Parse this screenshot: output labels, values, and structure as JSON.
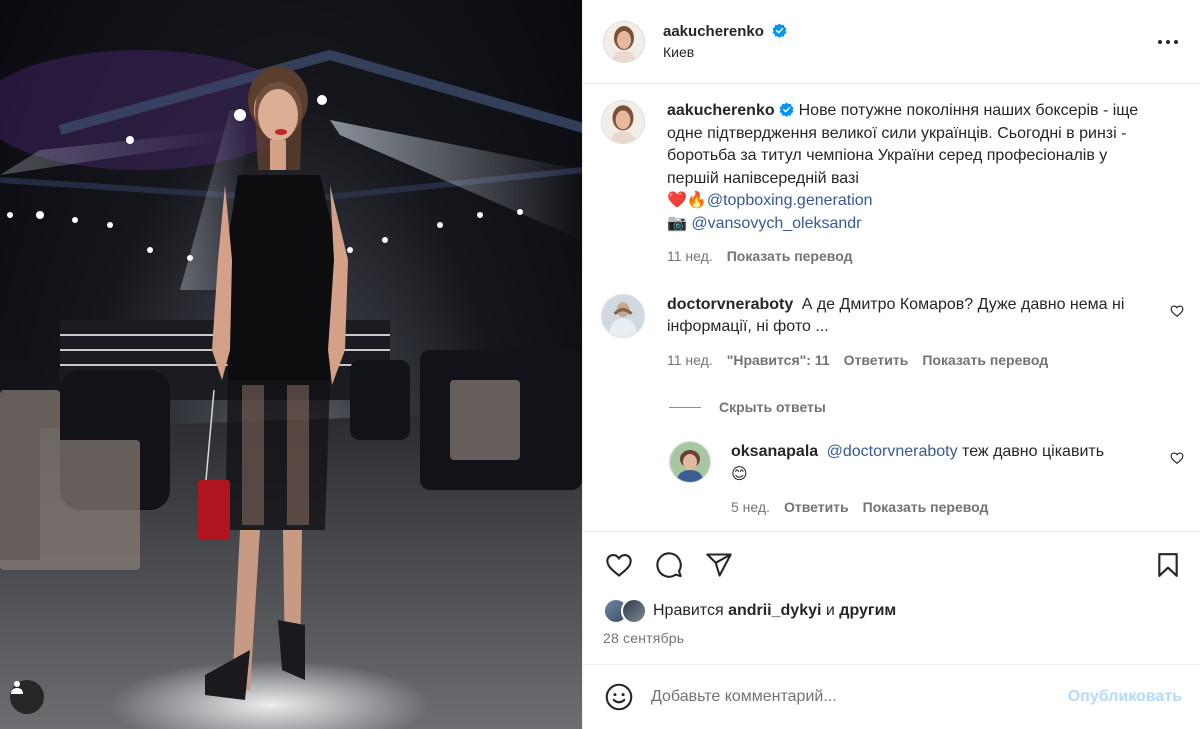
{
  "post": {
    "author": "aakucherenko",
    "location": "Киев",
    "caption_text": "Нове потужне покоління наших боксерів - іще одне підтвердження великої сили українців. Сьогодні в ринзі - боротьба за титул чемпіона України серед професіоналів у першій напівсередній вазі",
    "caption_emoji_1": "❤️🔥",
    "caption_mention_1": "@topboxing.generation",
    "caption_emoji_2": "📷",
    "caption_mention_2": "@vansovych_oleksandr",
    "caption_time": "11 нед.",
    "caption_translate": "Показать перевод"
  },
  "comments": [
    {
      "user": "doctorvneraboty",
      "text": "А де Дмитро Комаров? Дуже давно нема ні інформації, ні фото ...",
      "time": "11 нед.",
      "likes": "\"Нравится\": 11",
      "reply_label": "Ответить",
      "translate_label": "Показать перевод"
    }
  ],
  "hide_replies_label": "Скрыть ответы",
  "reply": {
    "user": "oksanapala",
    "mention": "@doctorvneraboty",
    "text": "теж давно цікавить",
    "emoji": "😊",
    "time": "5 нед.",
    "reply_label": "Ответить",
    "translate_label": "Показать перевод"
  },
  "likes": {
    "prefix": "Нравится",
    "user": "andrii_dykyi",
    "conj": "и",
    "others": "другим"
  },
  "date": "28 сентябрь",
  "add_comment": {
    "placeholder": "Добавьте комментарий...",
    "publish_label": "Опубликовать"
  },
  "colors": {
    "verified": "#0095f6",
    "mention": "#385898",
    "publish_disabled": "#b3dbff",
    "secondary_text": "#737373"
  },
  "icons": [
    "verified-badge-icon",
    "more-options-icon",
    "heart-icon",
    "comment-icon",
    "share-icon",
    "bookmark-icon",
    "emoji-icon",
    "user-tag-icon"
  ]
}
